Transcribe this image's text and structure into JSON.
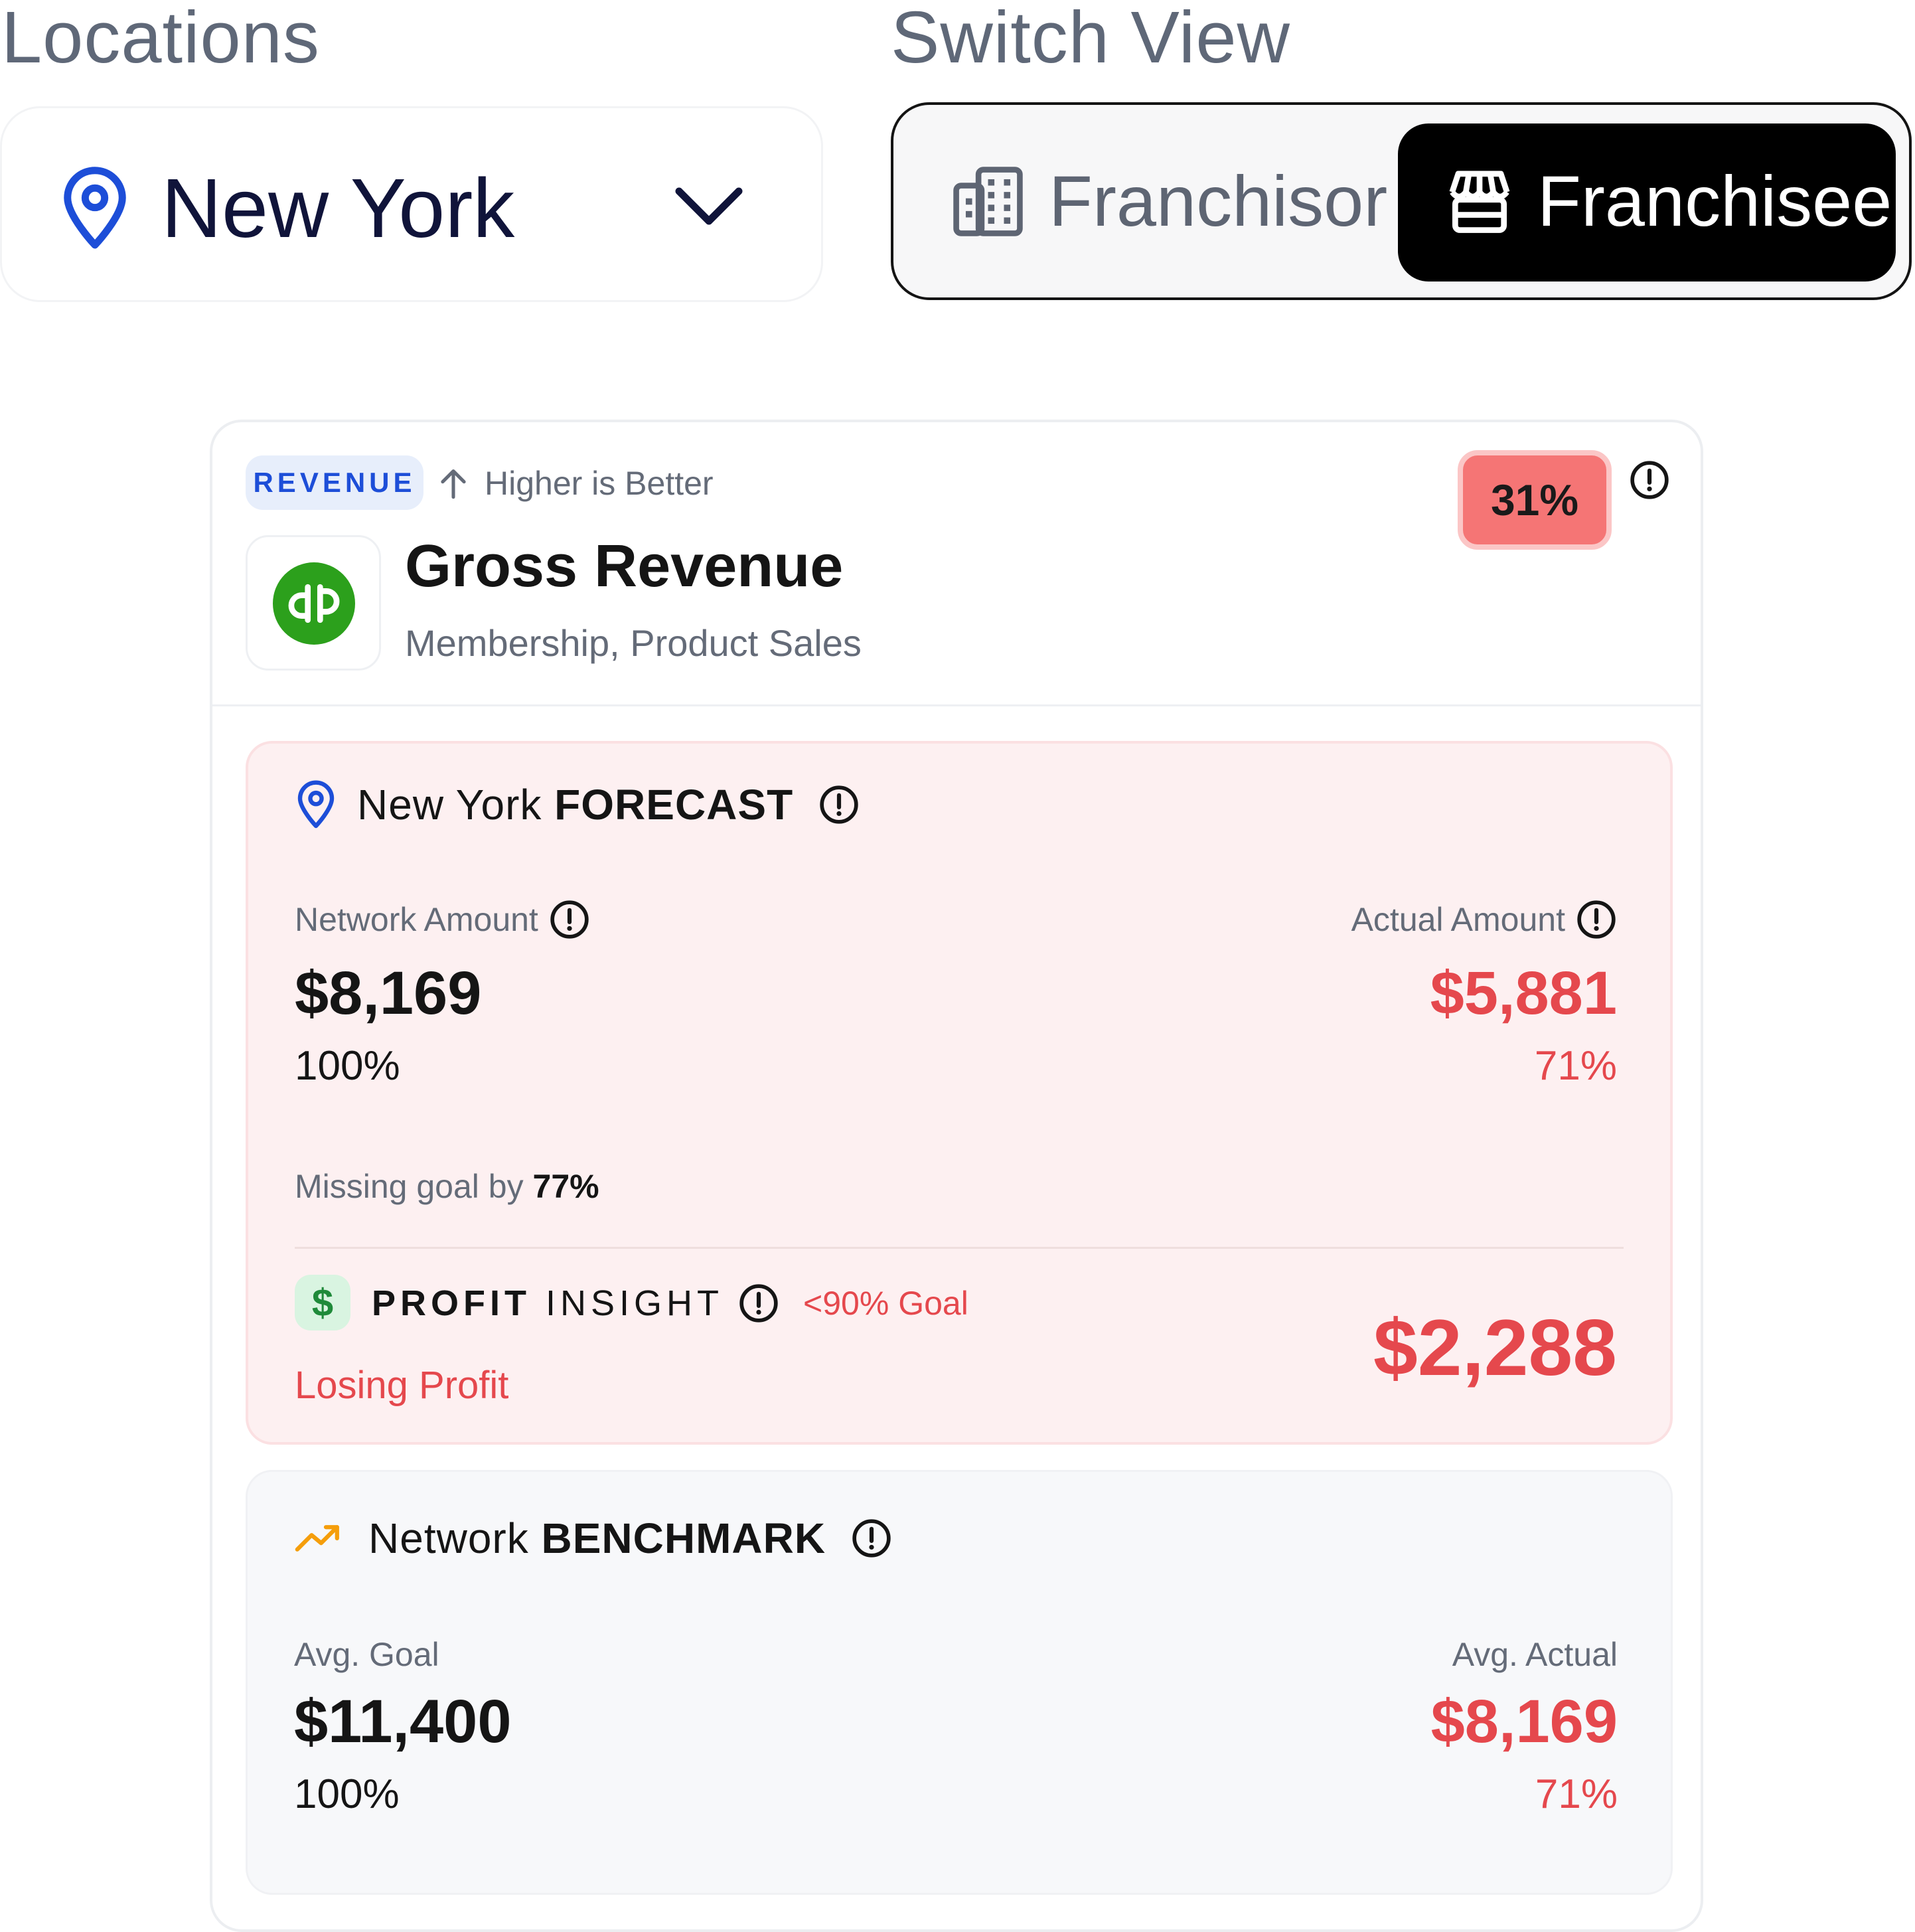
{
  "locations": {
    "label": "Locations",
    "selected": "New York"
  },
  "switch_view": {
    "label": "Switch View",
    "options": [
      "Franchisor",
      "Franchisee"
    ],
    "active": "Franchisee"
  },
  "card": {
    "category_badge": "REVENUE",
    "direction_hint": "Higher is Better",
    "title": "Gross Revenue",
    "subtitle": "Membership, Product Sales",
    "score_badge": "31%",
    "colors": {
      "accent_red": "#e5484d",
      "badge_red": "#f57575",
      "brand_green": "#2ca01c",
      "accent_blue": "#1d4ed8"
    },
    "forecast": {
      "location": "New York",
      "heading": "FORECAST",
      "network_label": "Network Amount",
      "network_value": "$8,169",
      "network_pct": "100%",
      "actual_label": "Actual Amount",
      "actual_value": "$5,881",
      "actual_pct": "71%",
      "missing_prefix": "Missing goal by",
      "missing_value": "77%",
      "profit_label_bold": "PROFIT",
      "profit_label_rest": "INSIGHT",
      "profit_goal": "<90% Goal",
      "profit_status": "Losing Profit",
      "profit_value": "$2,288",
      "dollar_symbol": "$"
    },
    "benchmark": {
      "prefix": "Network",
      "heading": "BENCHMARK",
      "goal_label": "Avg. Goal",
      "goal_value": "$11,400",
      "goal_pct": "100%",
      "actual_label": "Avg. Actual",
      "actual_value": "$8,169",
      "actual_pct": "71%"
    }
  }
}
